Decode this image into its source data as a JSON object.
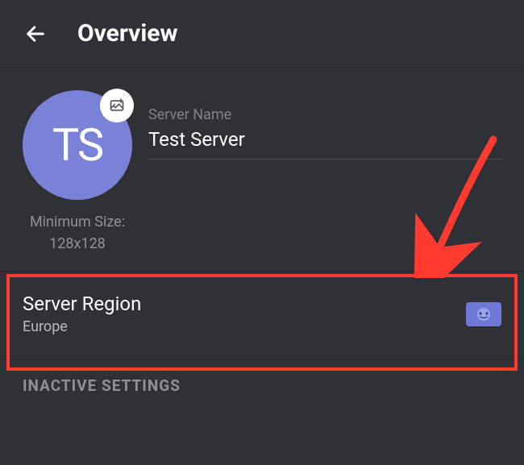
{
  "header": {
    "title": "Overview"
  },
  "server": {
    "initials": "TS",
    "min_size_label": "Minimum Size:",
    "min_size_value": "128x128",
    "name_label": "Server Name",
    "name_value": "Test Server"
  },
  "region": {
    "title": "Server Region",
    "value": "Europe"
  },
  "sections": {
    "inactive": "INACTIVE SETTINGS"
  }
}
